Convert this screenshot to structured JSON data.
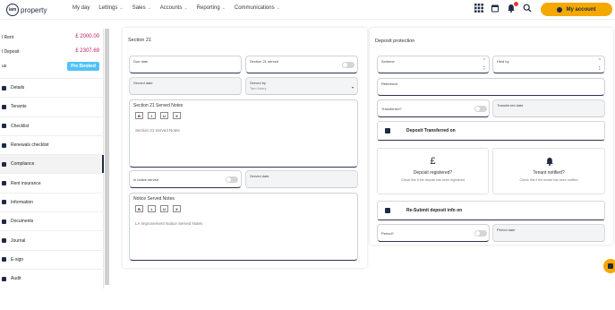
{
  "brand": {
    "iam": "iam",
    "property": "property"
  },
  "nav": [
    {
      "label": "My day",
      "chevron": false
    },
    {
      "label": "Lettings",
      "chevron": true
    },
    {
      "label": "Sales",
      "chevron": true
    },
    {
      "label": "Accounts",
      "chevron": true
    },
    {
      "label": "Reporting",
      "chevron": true
    },
    {
      "label": "Communications",
      "chevron": true
    }
  ],
  "account": {
    "label": "My account"
  },
  "sidebar": {
    "rent_label": "l Rent",
    "rent_value": "£ 2000.00",
    "deposit_label": "l Deposit",
    "deposit_value": "£ 2307.69",
    "status_label": "us",
    "status_badge": "Pre Booked",
    "items": [
      {
        "label": "Details",
        "icon": "home-icon"
      },
      {
        "label": "Tenants",
        "icon": "people-icon"
      },
      {
        "label": "Checklist",
        "icon": "check-icon"
      },
      {
        "label": "Renewals checklist",
        "icon": "renew-icon"
      },
      {
        "label": "Compliance",
        "icon": "shield-icon"
      },
      {
        "label": "Rent insurance",
        "icon": "shield-icon"
      },
      {
        "label": "Information",
        "icon": "info-icon"
      },
      {
        "label": "Documents",
        "icon": "folder-icon"
      },
      {
        "label": "Journal",
        "icon": "journal-icon"
      },
      {
        "label": "E-sign",
        "icon": "pen-icon"
      },
      {
        "label": "Audit",
        "icon": "audit-icon"
      }
    ]
  },
  "section21": {
    "title": "Section 21",
    "due_date": "Due date",
    "section21_served": "Section 21 served",
    "served_date": "Served date",
    "served_by_label": "Served by",
    "served_by_value": "Tom Harry",
    "notes_title": "Section 21 Served Notes",
    "notes_text": "Section 21 Served Notes",
    "notice_served": "Is notice served",
    "served_date2": "Served date",
    "notice_notes_title": "Notice Served Notes",
    "notice_notes_text": "LA Improvement Notice Served Notes"
  },
  "toolbar": {
    "bold": "B",
    "italic": "I",
    "underline": "U",
    "clear": "X"
  },
  "deposit": {
    "title": "Deposit protection",
    "scheme": "Scheme",
    "held_by": "Held by",
    "reference": "Reference",
    "transferred": "Transferred?",
    "transferred_date": "Transferred date",
    "bar1": "Deposit Transferred on",
    "registered_symbol": "£",
    "registered_title": "Deposit registered?",
    "registered_sub": "Check this if the deposit has been registered",
    "notified_title": "Tenant notified?",
    "notified_sub": "Check this if the tenant has been notified",
    "bar2": "Re-Submit deposit info on",
    "period": "Period?",
    "period_date": "Period date"
  }
}
